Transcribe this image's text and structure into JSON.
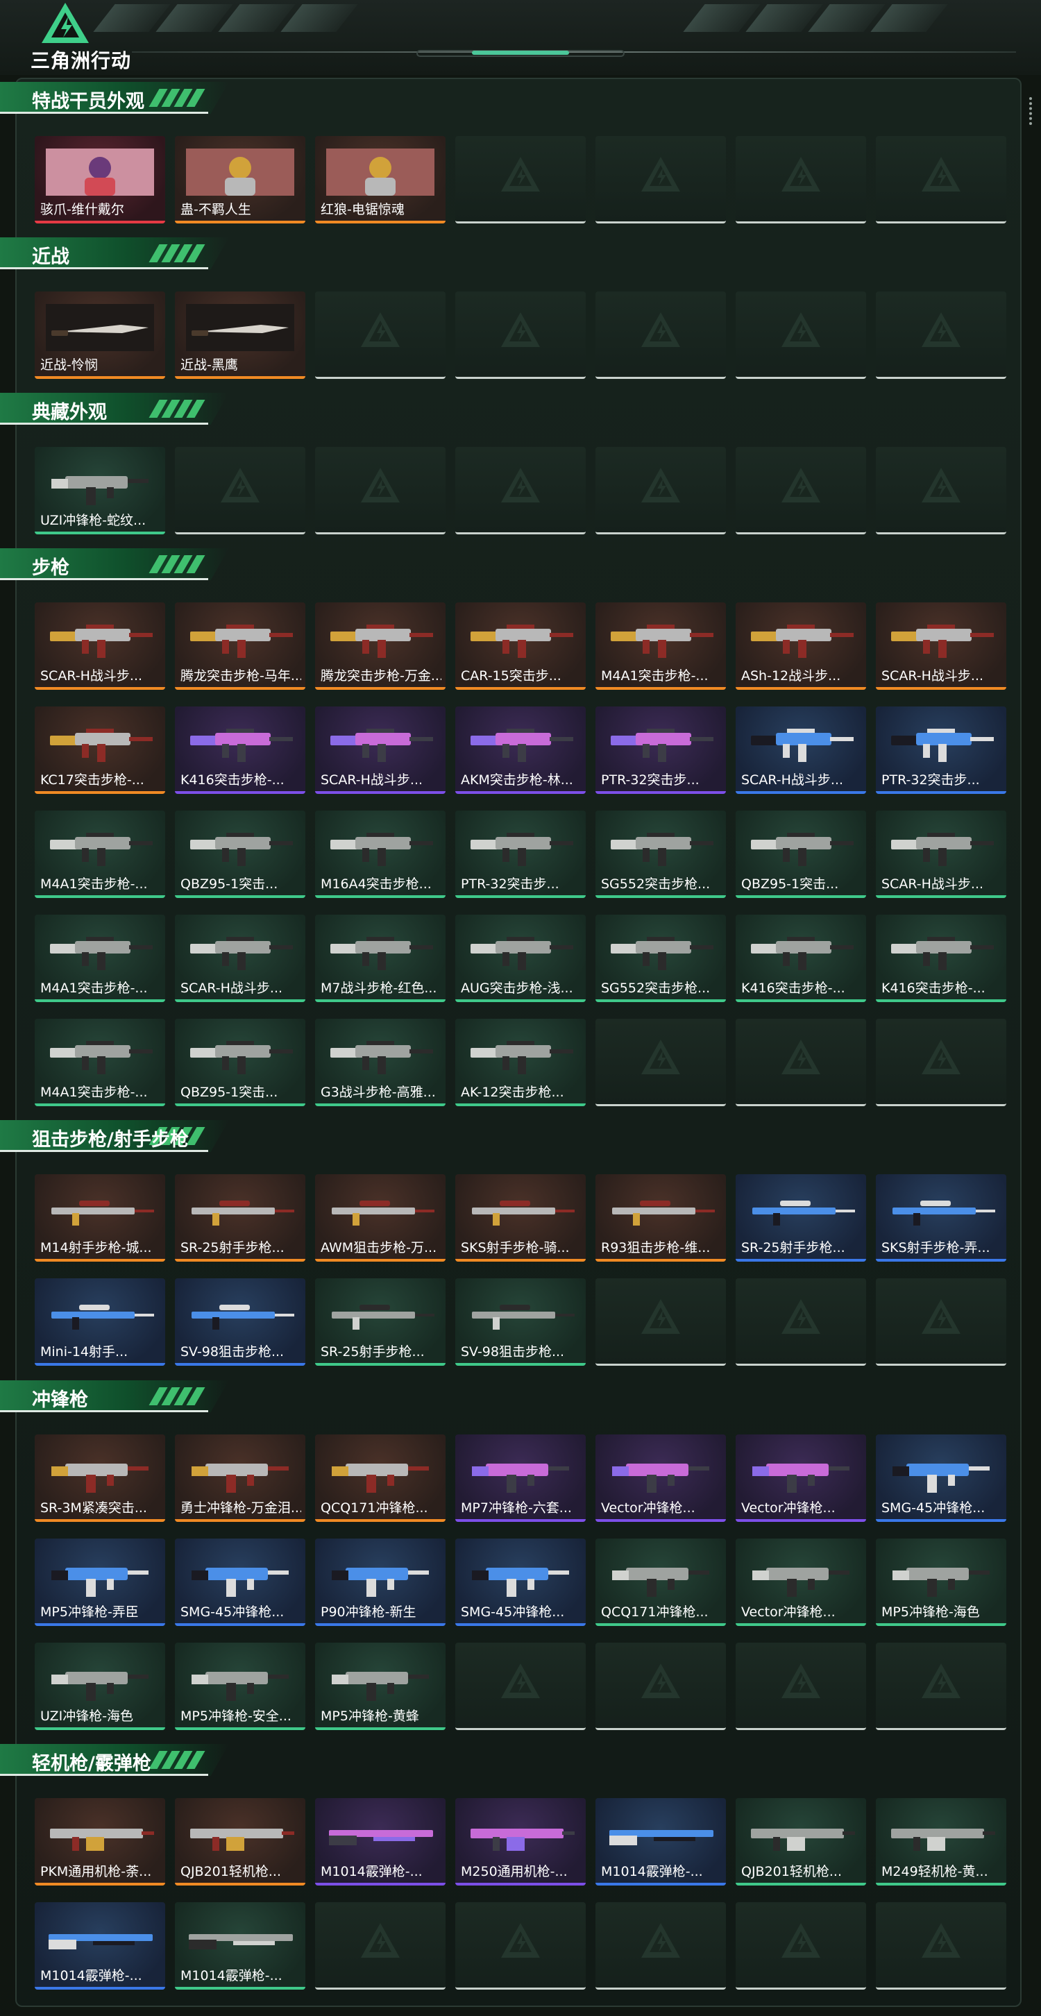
{
  "header": {
    "brand": "三角洲行动"
  },
  "colors": {
    "orange": "#f08a24",
    "purple": "#7c4fe8",
    "blue": "#3a78e8",
    "green": "#3fc98a",
    "red": "#e53a44",
    "accent": "#3fbf6e"
  },
  "sections": [
    {
      "title": "特战干员外观",
      "slots": 7,
      "items": [
        {
          "label": "骇爪-维什戴尔",
          "rarity": "red",
          "kind": "portrait"
        },
        {
          "label": "蛊-不羁人生",
          "rarity": "orange",
          "kind": "portrait"
        },
        {
          "label": "红狼-电锯惊魂",
          "rarity": "orange",
          "kind": "portrait"
        }
      ]
    },
    {
      "title": "近战",
      "slots": 7,
      "items": [
        {
          "label": "近战-怜悯",
          "rarity": "orange",
          "kind": "knife"
        },
        {
          "label": "近战-黑鹰",
          "rarity": "orange",
          "kind": "knife"
        }
      ]
    },
    {
      "title": "典藏外观",
      "slots": 7,
      "items": [
        {
          "label": "UZI冲锋枪-蛇纹...",
          "rarity": "green",
          "kind": "smg"
        }
      ]
    },
    {
      "title": "步枪",
      "slots": 35,
      "items": [
        {
          "label": "SCAR-H战斗步...",
          "rarity": "orange",
          "kind": "rifle"
        },
        {
          "label": "腾龙突击步枪-马年...",
          "rarity": "orange",
          "kind": "rifle"
        },
        {
          "label": "腾龙突击步枪-万金...",
          "rarity": "orange",
          "kind": "rifle"
        },
        {
          "label": "CAR-15突击步...",
          "rarity": "orange",
          "kind": "rifle"
        },
        {
          "label": "M4A1突击步枪-...",
          "rarity": "orange",
          "kind": "rifle"
        },
        {
          "label": "ASh-12战斗步...",
          "rarity": "orange",
          "kind": "rifle"
        },
        {
          "label": "SCAR-H战斗步...",
          "rarity": "orange",
          "kind": "rifle"
        },
        {
          "label": "KC17突击步枪-...",
          "rarity": "orange",
          "kind": "rifle"
        },
        {
          "label": "K416突击步枪-...",
          "rarity": "purple",
          "kind": "rifle"
        },
        {
          "label": "SCAR-H战斗步...",
          "rarity": "purple",
          "kind": "rifle"
        },
        {
          "label": "AKM突击步枪-林...",
          "rarity": "purple",
          "kind": "rifle"
        },
        {
          "label": "PTR-32突击步...",
          "rarity": "purple",
          "kind": "rifle"
        },
        {
          "label": "SCAR-H战斗步...",
          "rarity": "blue",
          "kind": "rifle"
        },
        {
          "label": "PTR-32突击步...",
          "rarity": "blue",
          "kind": "rifle"
        },
        {
          "label": "M4A1突击步枪-...",
          "rarity": "green",
          "kind": "rifle"
        },
        {
          "label": "QBZ95-1突击...",
          "rarity": "green",
          "kind": "rifle"
        },
        {
          "label": "M16A4突击步枪...",
          "rarity": "green",
          "kind": "rifle"
        },
        {
          "label": "PTR-32突击步...",
          "rarity": "green",
          "kind": "rifle"
        },
        {
          "label": "SG552突击步枪...",
          "rarity": "green",
          "kind": "rifle"
        },
        {
          "label": "QBZ95-1突击...",
          "rarity": "green",
          "kind": "rifle"
        },
        {
          "label": "SCAR-H战斗步...",
          "rarity": "green",
          "kind": "rifle"
        },
        {
          "label": "M4A1突击步枪-...",
          "rarity": "green",
          "kind": "rifle"
        },
        {
          "label": "SCAR-H战斗步...",
          "rarity": "green",
          "kind": "rifle"
        },
        {
          "label": "M7战斗步枪-红色...",
          "rarity": "green",
          "kind": "rifle"
        },
        {
          "label": "AUG突击步枪-浅...",
          "rarity": "green",
          "kind": "rifle"
        },
        {
          "label": "SG552突击步枪...",
          "rarity": "green",
          "kind": "rifle"
        },
        {
          "label": "K416突击步枪-...",
          "rarity": "green",
          "kind": "rifle"
        },
        {
          "label": "K416突击步枪-...",
          "rarity": "green",
          "kind": "rifle"
        },
        {
          "label": "M4A1突击步枪-...",
          "rarity": "green",
          "kind": "rifle"
        },
        {
          "label": "QBZ95-1突击...",
          "rarity": "green",
          "kind": "rifle"
        },
        {
          "label": "G3战斗步枪-高雅...",
          "rarity": "green",
          "kind": "rifle"
        },
        {
          "label": "AK-12突击步枪...",
          "rarity": "green",
          "kind": "rifle"
        }
      ]
    },
    {
      "title": "狙击步枪/射手步枪",
      "slots": 14,
      "items": [
        {
          "label": "M14射手步枪-城...",
          "rarity": "orange",
          "kind": "sniper"
        },
        {
          "label": "SR-25射手步枪...",
          "rarity": "orange",
          "kind": "sniper"
        },
        {
          "label": "AWM狙击步枪-万...",
          "rarity": "orange",
          "kind": "sniper"
        },
        {
          "label": "SKS射手步枪-骑...",
          "rarity": "orange",
          "kind": "sniper"
        },
        {
          "label": "R93狙击步枪-维...",
          "rarity": "orange",
          "kind": "sniper"
        },
        {
          "label": "SR-25射手步枪...",
          "rarity": "blue",
          "kind": "sniper"
        },
        {
          "label": "SKS射手步枪-弄...",
          "rarity": "blue",
          "kind": "sniper"
        },
        {
          "label": "Mini-14射手...",
          "rarity": "blue",
          "kind": "sniper"
        },
        {
          "label": "SV-98狙击步枪...",
          "rarity": "blue",
          "kind": "sniper"
        },
        {
          "label": "SR-25射手步枪...",
          "rarity": "green",
          "kind": "sniper"
        },
        {
          "label": "SV-98狙击步枪...",
          "rarity": "green",
          "kind": "sniper"
        }
      ]
    },
    {
      "title": "冲锋枪",
      "slots": 21,
      "items": [
        {
          "label": "SR-3M紧凑突击...",
          "rarity": "orange",
          "kind": "smg"
        },
        {
          "label": "勇士冲锋枪-万金泪...",
          "rarity": "orange",
          "kind": "smg"
        },
        {
          "label": "QCQ171冲锋枪...",
          "rarity": "orange",
          "kind": "smg"
        },
        {
          "label": "MP7冲锋枪-六套...",
          "rarity": "purple",
          "kind": "smg"
        },
        {
          "label": "Vector冲锋枪...",
          "rarity": "purple",
          "kind": "smg"
        },
        {
          "label": "Vector冲锋枪...",
          "rarity": "purple",
          "kind": "smg"
        },
        {
          "label": "SMG-45冲锋枪...",
          "rarity": "blue",
          "kind": "smg"
        },
        {
          "label": "MP5冲锋枪-弄臣",
          "rarity": "blue",
          "kind": "smg"
        },
        {
          "label": "SMG-45冲锋枪...",
          "rarity": "blue",
          "kind": "smg"
        },
        {
          "label": "P90冲锋枪-新生",
          "rarity": "blue",
          "kind": "smg"
        },
        {
          "label": "SMG-45冲锋枪...",
          "rarity": "blue",
          "kind": "smg"
        },
        {
          "label": "QCQ171冲锋枪...",
          "rarity": "green",
          "kind": "smg"
        },
        {
          "label": "Vector冲锋枪...",
          "rarity": "green",
          "kind": "smg"
        },
        {
          "label": "MP5冲锋枪-海色",
          "rarity": "green",
          "kind": "smg"
        },
        {
          "label": "UZI冲锋枪-海色",
          "rarity": "green",
          "kind": "smg"
        },
        {
          "label": "MP5冲锋枪-安全...",
          "rarity": "green",
          "kind": "smg"
        },
        {
          "label": "MP5冲锋枪-黄蜂",
          "rarity": "green",
          "kind": "smg"
        }
      ]
    },
    {
      "title": "轻机枪/霰弹枪",
      "slots": 14,
      "items": [
        {
          "label": "PKM通用机枪-荼...",
          "rarity": "orange",
          "kind": "lmg"
        },
        {
          "label": "QJB201轻机枪...",
          "rarity": "orange",
          "kind": "lmg"
        },
        {
          "label": "M1014霰弹枪-...",
          "rarity": "purple",
          "kind": "shotgun"
        },
        {
          "label": "M250通用机枪-...",
          "rarity": "purple",
          "kind": "lmg"
        },
        {
          "label": "M1014霰弹枪-...",
          "rarity": "blue",
          "kind": "shotgun"
        },
        {
          "label": "QJB201轻机枪...",
          "rarity": "green",
          "kind": "lmg"
        },
        {
          "label": "M249轻机枪-黄...",
          "rarity": "green",
          "kind": "lmg"
        },
        {
          "label": "M1014霰弹枪-...",
          "rarity": "blue",
          "kind": "shotgun"
        },
        {
          "label": "M1014霰弹枪-...",
          "rarity": "green",
          "kind": "shotgun"
        }
      ]
    }
  ]
}
